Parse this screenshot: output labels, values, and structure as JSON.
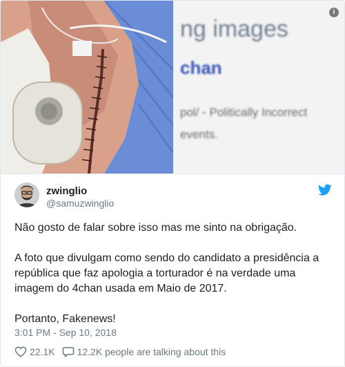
{
  "media": {
    "right_text": {
      "line1": "ng images",
      "line2": "chan",
      "line3": "pol/ - Politically Incorrect",
      "line4": "events."
    },
    "info_glyph": "i"
  },
  "tweet": {
    "display_name": "zwinglio",
    "handle": "@samuzwinglio",
    "paragraphs": [
      "Não gosto de falar sobre isso mas me sinto na obrigação.",
      "A foto que divulgam como sendo do candidato a presidência a república que faz apologia a torturador é na verdade uma imagem do 4chan usada em Maio de 2017.",
      "Portanto, Fakenews!"
    ],
    "timestamp": "3:01 PM - Sep 10, 2018",
    "likes": "22.1K",
    "replies_text": "12.2K people are talking about this"
  },
  "colors": {
    "twitter_blue": "#1da1f2",
    "muted": "#697882",
    "border": "#e1e8ed"
  },
  "icons": {
    "info": "info-icon",
    "twitter": "twitter-bird-icon",
    "like": "heart-icon",
    "reply": "speech-bubble-icon"
  }
}
